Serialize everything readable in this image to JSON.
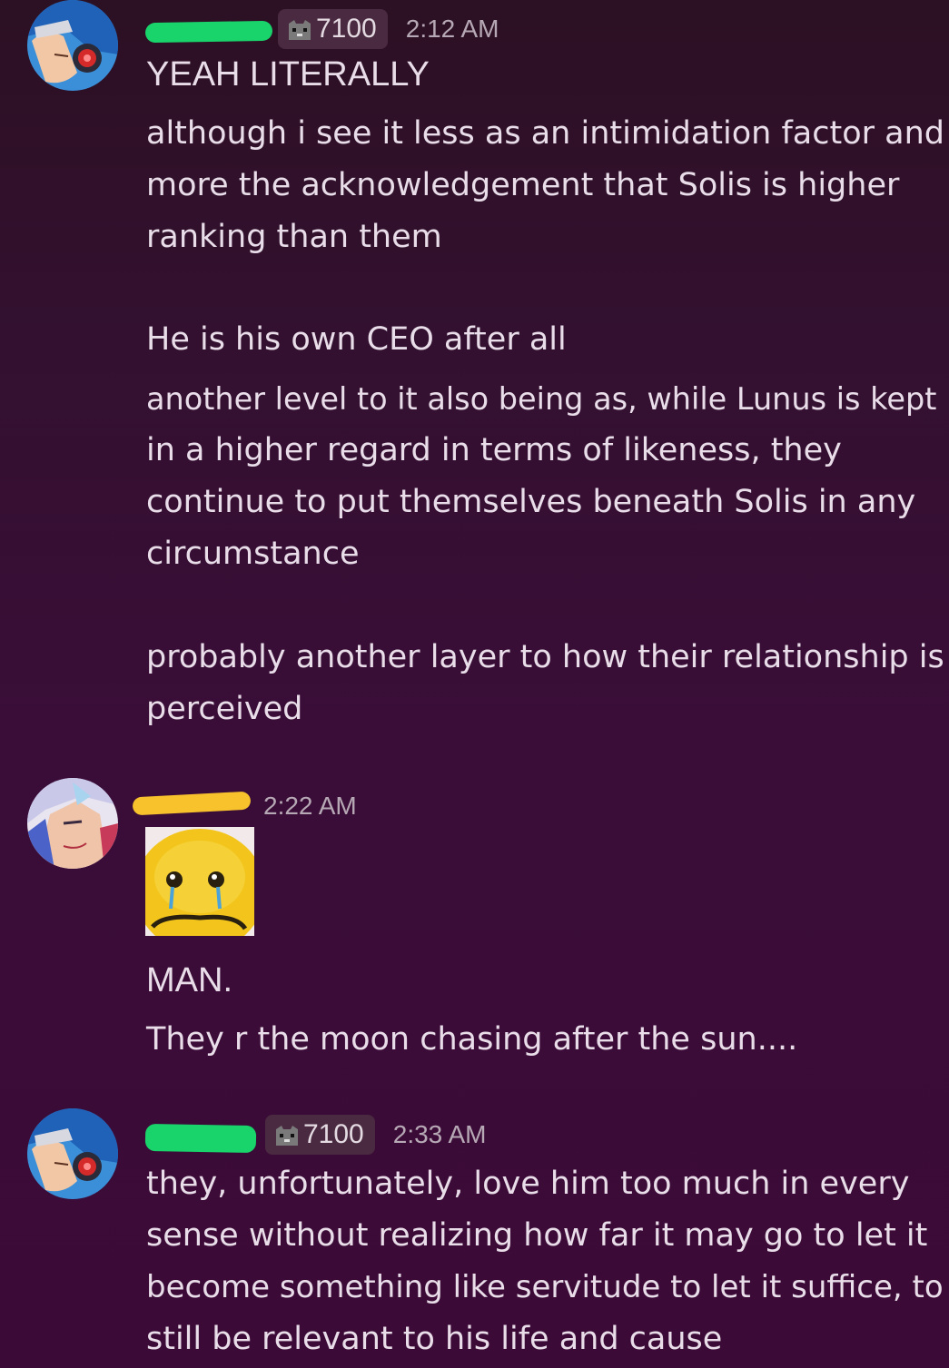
{
  "messages": [
    {
      "tag_number": "7100",
      "time": "2:12 AM",
      "lines": [
        "YEAH LITERALLY",
        "although i see it less as an intimidation factor and",
        "more the acknowledgement that Solis is higher",
        "ranking than them",
        "He is his own CEO after all",
        "another level to it also being as, while Lunus is kept",
        "in a higher regard in terms of likeness, they",
        "continue to put themselves beneath Solis in any",
        "circumstance",
        "probably another layer to how their relationship is",
        "perceived"
      ]
    },
    {
      "time": "2:22 AM",
      "emoji": "crying-face-emoji",
      "lines": [
        "MAN.",
        "They r the moon chasing after the sun...."
      ]
    },
    {
      "tag_number": "7100",
      "time": "2:33 AM",
      "lines": [
        "they, unfortunately, love him too much in every",
        "sense without realizing how far it may go to let it",
        "become something like servitude to let it suffice, to",
        "still be relevant to his life and cause"
      ]
    }
  ],
  "colors": {
    "background_top": "#2c1023",
    "background_bottom": "#3c0a37",
    "redaction_green": "#19d36b",
    "redaction_yellow": "#f7c22c",
    "tag_background": "#4a2a40"
  }
}
